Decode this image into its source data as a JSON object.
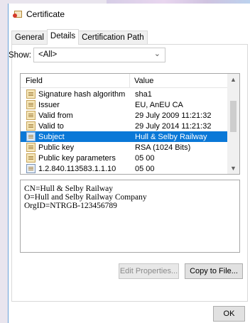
{
  "window": {
    "title": "Certificate"
  },
  "tabs": [
    {
      "label": "General",
      "active": false
    },
    {
      "label": "Details",
      "active": true
    },
    {
      "label": "Certification Path",
      "active": false
    }
  ],
  "show": {
    "label": "Show:",
    "selected": "<All>"
  },
  "list": {
    "columns": {
      "field": "Field",
      "value": "Value"
    },
    "rows": [
      {
        "field": "Signature hash algorithm",
        "value": "sha1",
        "icon": "certificate-field-icon",
        "selected": false
      },
      {
        "field": "Issuer",
        "value": "EU, AnEU CA",
        "icon": "certificate-field-icon",
        "selected": false
      },
      {
        "field": "Valid from",
        "value": "29 July 2009 11:21:32",
        "icon": "certificate-field-icon",
        "selected": false
      },
      {
        "field": "Valid to",
        "value": "29 July 2014 11:21:32",
        "icon": "certificate-field-icon",
        "selected": false
      },
      {
        "field": "Subject",
        "value": "Hull & Selby Railway",
        "icon": "certificate-field-icon",
        "selected": true
      },
      {
        "field": "Public key",
        "value": "RSA (1024 Bits)",
        "icon": "certificate-field-icon",
        "selected": false
      },
      {
        "field": "Public key parameters",
        "value": "05 00",
        "icon": "certificate-field-icon",
        "selected": false
      },
      {
        "field": "1.2.840.113583.1.1.10",
        "value": "05 00",
        "icon": "extension-icon",
        "selected": false
      }
    ]
  },
  "detail": {
    "lines": [
      "CN=Hull & Selby Railway",
      "O=Hull and Selby Railway Company",
      "OrgID=NTRGB-123456789"
    ]
  },
  "buttons": {
    "edit_properties": "Edit Properties...",
    "copy_to_file": "Copy to File...",
    "ok": "OK"
  },
  "colors": {
    "selection": "#0a78d7",
    "window_border": "#6aa1d8"
  }
}
